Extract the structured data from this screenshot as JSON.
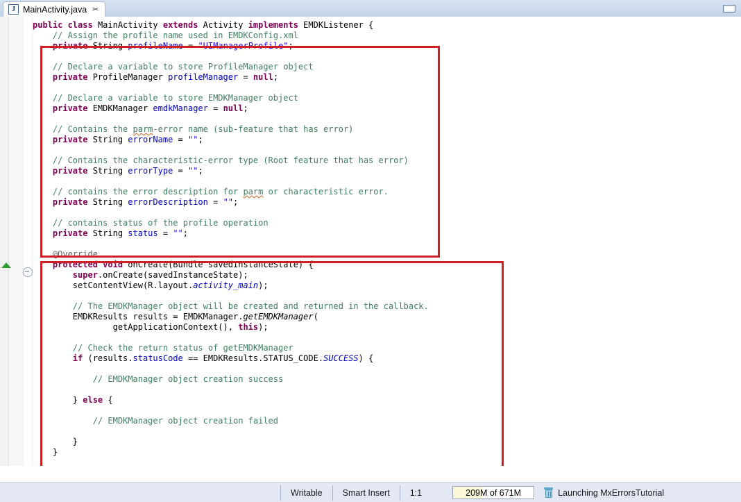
{
  "window": {
    "minimize_label": "□"
  },
  "tab": {
    "icon": "java-file-icon",
    "label": "MainActivity.java",
    "close_glyph": "✂"
  },
  "editor": {
    "fold_icon": "collapse-fold-icon",
    "overview_marker": "green-up-triangle-marker",
    "code_lines": [
      [
        {
          "t": "public ",
          "c": "kw"
        },
        {
          "t": "class ",
          "c": "kw"
        },
        {
          "t": "MainActivity ",
          "c": "plain"
        },
        {
          "t": "extends ",
          "c": "kw"
        },
        {
          "t": "Activity ",
          "c": "plain"
        },
        {
          "t": "implements ",
          "c": "kw"
        },
        {
          "t": "EMDKListener {",
          "c": "plain"
        }
      ],
      [
        {
          "t": "    // Assign the profile name used in EMDKConfig.xml",
          "c": "cmt"
        }
      ],
      [
        {
          "t": "    ",
          "c": "plain"
        },
        {
          "t": "private ",
          "c": "kw"
        },
        {
          "t": "String ",
          "c": "plain"
        },
        {
          "t": "profileName",
          "c": "fld"
        },
        {
          "t": " = ",
          "c": "plain"
        },
        {
          "t": "\"UIManagerProfile\"",
          "c": "str"
        },
        {
          "t": ";",
          "c": "plain"
        }
      ],
      [
        {
          "t": "",
          "c": "plain"
        }
      ],
      [
        {
          "t": "    // Declare a variable to store ProfileManager object",
          "c": "cmt"
        }
      ],
      [
        {
          "t": "    ",
          "c": "plain"
        },
        {
          "t": "private ",
          "c": "kw"
        },
        {
          "t": "ProfileManager ",
          "c": "plain"
        },
        {
          "t": "profileManager",
          "c": "fld"
        },
        {
          "t": " = ",
          "c": "plain"
        },
        {
          "t": "null",
          "c": "kw"
        },
        {
          "t": ";",
          "c": "plain"
        }
      ],
      [
        {
          "t": "",
          "c": "plain"
        }
      ],
      [
        {
          "t": "    // Declare a variable to store EMDKManager object",
          "c": "cmt"
        }
      ],
      [
        {
          "t": "    ",
          "c": "plain"
        },
        {
          "t": "private ",
          "c": "kw"
        },
        {
          "t": "EMDKManager ",
          "c": "plain"
        },
        {
          "t": "emdkManager",
          "c": "fld"
        },
        {
          "t": " = ",
          "c": "plain"
        },
        {
          "t": "null",
          "c": "kw"
        },
        {
          "t": ";",
          "c": "plain"
        }
      ],
      [
        {
          "t": "",
          "c": "plain"
        }
      ],
      [
        {
          "t": "    // Contains the ",
          "c": "cmt"
        },
        {
          "t": "parm",
          "c": "cmt spell"
        },
        {
          "t": "-error name (sub-feature that has error)",
          "c": "cmt"
        }
      ],
      [
        {
          "t": "    ",
          "c": "plain"
        },
        {
          "t": "private ",
          "c": "kw"
        },
        {
          "t": "String ",
          "c": "plain"
        },
        {
          "t": "errorName",
          "c": "fld"
        },
        {
          "t": " = ",
          "c": "plain"
        },
        {
          "t": "\"\"",
          "c": "str"
        },
        {
          "t": ";",
          "c": "plain"
        }
      ],
      [
        {
          "t": "",
          "c": "plain"
        }
      ],
      [
        {
          "t": "    // Contains the characteristic-error type (Root feature that has error)",
          "c": "cmt"
        }
      ],
      [
        {
          "t": "    ",
          "c": "plain"
        },
        {
          "t": "private ",
          "c": "kw"
        },
        {
          "t": "String ",
          "c": "plain"
        },
        {
          "t": "errorType",
          "c": "fld"
        },
        {
          "t": " = ",
          "c": "plain"
        },
        {
          "t": "\"\"",
          "c": "str"
        },
        {
          "t": ";",
          "c": "plain"
        }
      ],
      [
        {
          "t": "",
          "c": "plain"
        }
      ],
      [
        {
          "t": "    // contains the error description for ",
          "c": "cmt"
        },
        {
          "t": "parm",
          "c": "cmt spell"
        },
        {
          "t": " or characteristic error.",
          "c": "cmt"
        }
      ],
      [
        {
          "t": "    ",
          "c": "plain"
        },
        {
          "t": "private ",
          "c": "kw"
        },
        {
          "t": "String ",
          "c": "plain"
        },
        {
          "t": "errorDescription",
          "c": "fld"
        },
        {
          "t": " = ",
          "c": "plain"
        },
        {
          "t": "\"\"",
          "c": "str"
        },
        {
          "t": ";",
          "c": "plain"
        }
      ],
      [
        {
          "t": "",
          "c": "plain"
        }
      ],
      [
        {
          "t": "    // contains status of the profile operation",
          "c": "cmt"
        }
      ],
      [
        {
          "t": "    ",
          "c": "plain"
        },
        {
          "t": "private ",
          "c": "kw"
        },
        {
          "t": "String ",
          "c": "plain"
        },
        {
          "t": "status",
          "c": "fld"
        },
        {
          "t": " = ",
          "c": "plain"
        },
        {
          "t": "\"\"",
          "c": "str"
        },
        {
          "t": ";",
          "c": "plain"
        }
      ],
      [
        {
          "t": "",
          "c": "plain"
        }
      ],
      [
        {
          "t": "    @Override",
          "c": "anno"
        }
      ],
      [
        {
          "t": "    ",
          "c": "plain"
        },
        {
          "t": "protected ",
          "c": "kw"
        },
        {
          "t": "void ",
          "c": "kw"
        },
        {
          "t": "onCreate(Bundle savedInstanceState) {",
          "c": "plain"
        }
      ],
      [
        {
          "t": "        ",
          "c": "plain"
        },
        {
          "t": "super",
          "c": "kw"
        },
        {
          "t": ".onCreate(savedInstanceState);",
          "c": "plain"
        }
      ],
      [
        {
          "t": "        setContentView(R.layout.",
          "c": "plain"
        },
        {
          "t": "activity_main",
          "c": "sfld"
        },
        {
          "t": ");",
          "c": "plain"
        }
      ],
      [
        {
          "t": "",
          "c": "plain"
        }
      ],
      [
        {
          "t": "        // The EMDKManager object will be created and returned in the callback.",
          "c": "cmt"
        }
      ],
      [
        {
          "t": "        EMDKResults results = EMDKManager.",
          "c": "plain"
        },
        {
          "t": "getEMDKManager",
          "c": "smeth"
        },
        {
          "t": "(",
          "c": "plain"
        }
      ],
      [
        {
          "t": "                getApplicationContext(), ",
          "c": "plain"
        },
        {
          "t": "this",
          "c": "kw"
        },
        {
          "t": ");",
          "c": "plain"
        }
      ],
      [
        {
          "t": "",
          "c": "plain"
        }
      ],
      [
        {
          "t": "        // Check the return status of getEMDKManager",
          "c": "cmt"
        }
      ],
      [
        {
          "t": "        ",
          "c": "plain"
        },
        {
          "t": "if ",
          "c": "kw"
        },
        {
          "t": "(results.",
          "c": "plain"
        },
        {
          "t": "statusCode",
          "c": "fld"
        },
        {
          "t": " == EMDKResults.STATUS_CODE.",
          "c": "plain"
        },
        {
          "t": "SUCCESS",
          "c": "sfld"
        },
        {
          "t": ") {",
          "c": "plain"
        }
      ],
      [
        {
          "t": "",
          "c": "plain"
        }
      ],
      [
        {
          "t": "            // EMDKManager object creation success",
          "c": "cmt"
        }
      ],
      [
        {
          "t": "",
          "c": "plain"
        }
      ],
      [
        {
          "t": "        } ",
          "c": "plain"
        },
        {
          "t": "else ",
          "c": "kw"
        },
        {
          "t": "{",
          "c": "plain"
        }
      ],
      [
        {
          "t": "",
          "c": "plain"
        }
      ],
      [
        {
          "t": "            // EMDKManager object creation failed",
          "c": "cmt"
        }
      ],
      [
        {
          "t": "",
          "c": "plain"
        }
      ],
      [
        {
          "t": "        }",
          "c": "plain"
        }
      ],
      [
        {
          "t": "    }",
          "c": "plain"
        }
      ]
    ]
  },
  "annotations": {
    "box_color": "#cc2026",
    "boxes": [
      {
        "name": "fields-highlight-box"
      },
      {
        "name": "oncreate-highlight-box"
      }
    ]
  },
  "scrollbar": {
    "left_arrow": "scroll-left-arrow",
    "right_arrow": "scroll-right-arrow"
  },
  "status_bar": {
    "writable": "Writable",
    "insert_mode": "Smart Insert",
    "cursor_position": "1:1",
    "memory": "209M of 671M",
    "memory_used_percent": 36,
    "trash_icon": "trash-can-icon",
    "launch_status": "Launching MxErrorsTutorial"
  }
}
